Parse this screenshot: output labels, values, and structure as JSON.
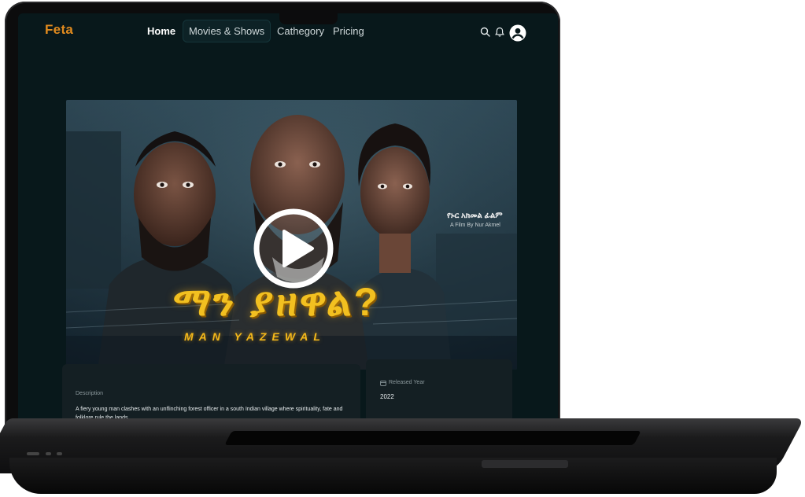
{
  "nav": {
    "logo": "Feta",
    "links": [
      "Home",
      "Movies & Shows",
      "Cathegory",
      "Pricing"
    ],
    "icons": [
      "search-icon",
      "bell-icon",
      "user-avatar-icon"
    ]
  },
  "hero": {
    "title_amharic": "ማን ያዘዋል?",
    "title_english": "MAN YAZEWAL",
    "credit_amharic": "የኑር አክመል ፊልም",
    "credit_english": "A Film By Nur Akmel",
    "play_icon": "play-icon"
  },
  "description": {
    "label": "Description",
    "text": "A fiery young man clashes with an unflinching forest officer in a south Indian village where spirituality, fate and folklore rule the lands."
  },
  "release": {
    "label": "Released Year",
    "icon": "calendar-icon",
    "value": "2022"
  },
  "colors": {
    "accent": "#e08a1e",
    "background": "#08181b",
    "card": "#141f23",
    "title_gold": "#f2c020"
  }
}
